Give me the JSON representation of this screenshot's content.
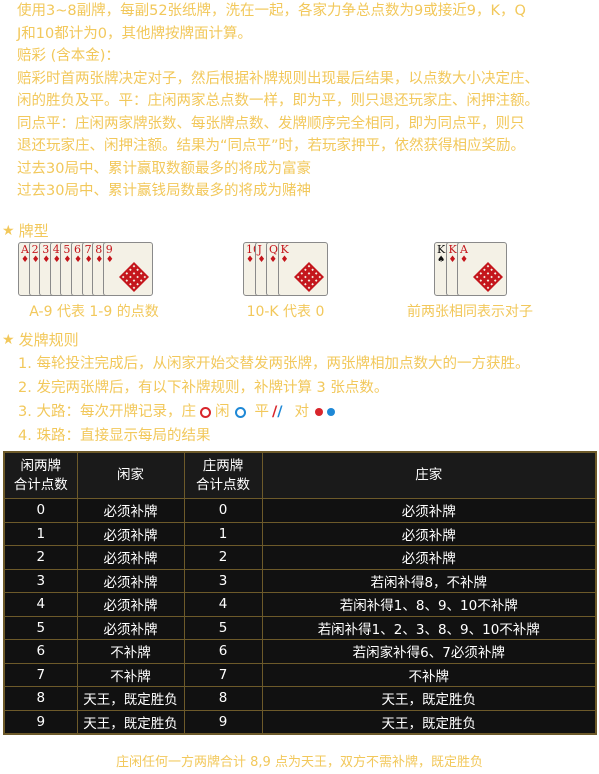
{
  "intro": [
    "使用3~8副牌，每副52张纸牌，洗在一起，各家力争总点数为9或接近9，K，Q",
    "J和10都计为0，其他牌按牌面计算。",
    "赔彩 (含本金)：",
    "赔彩时首两张牌决定对子，然后根据补牌规则出现最后结果，以点数大小决定庄、",
    "闲的胜负及平。平：庄闲两家总点数一样，即为平，则只退还玩家庄、闲押注额。",
    "同点平：庄闲两家牌张数、每张牌点数、发牌顺序完全相同，即为同点平，则只",
    "退还玩家庄、闲押注额。结果为“同点平”时，若玩家押平，依然获得相应奖励。",
    "过去30局中、累计赢取数额最多的将成为富豪",
    "过去30局中、累计赢钱局数最多的将成为赌神"
  ],
  "card_section": {
    "title": "牌型",
    "groups": [
      {
        "ranks": [
          "A",
          "2",
          "3",
          "4",
          "5",
          "6",
          "7",
          "8",
          "9"
        ],
        "caption": "A-9 代表 1-9 的点数"
      },
      {
        "ranks": [
          "10",
          "J",
          "Q",
          "K"
        ],
        "caption": "10-K 代表 0"
      },
      {
        "ranks": [
          "K",
          "K",
          "A"
        ],
        "caption": "前两张相同表示对子"
      }
    ]
  },
  "deal_section": {
    "title": "发牌规则",
    "rule1": "1. 每轮投注完成后，从闲家开始交替发两张牌，两张牌相加点数大的一方获胜。",
    "rule2": "2. 发完两张牌后，有以下补牌规则，补牌计算 3 张点数。",
    "rule3_prefix": "3. 大路：每次开牌记录，庄",
    "rule3_player": "闲",
    "rule3_tie": "平",
    "rule3_pair": "对",
    "rule4": "4. 珠路：直接显示每局的结果"
  },
  "table": {
    "headers": [
      "闲两牌\n合计点数",
      "闲家",
      "庄两牌\n合计点数",
      "庄家"
    ],
    "header_col1_line1": "闲两牌",
    "header_col1_line2": "合计点数",
    "header_col2": "闲家",
    "header_col3_line1": "庄两牌",
    "header_col3_line2": "合计点数",
    "header_col4": "庄家",
    "rows": [
      [
        "0",
        "必须补牌",
        "0",
        "必须补牌"
      ],
      [
        "1",
        "必须补牌",
        "1",
        "必须补牌"
      ],
      [
        "2",
        "必须补牌",
        "2",
        "必须补牌"
      ],
      [
        "3",
        "必须补牌",
        "3",
        "若闲补得8，不补牌"
      ],
      [
        "4",
        "必须补牌",
        "4",
        "若闲补得1、8、9、10不补牌"
      ],
      [
        "5",
        "必须补牌",
        "5",
        "若闲补得1、2、3、8、9、10不补牌"
      ],
      [
        "6",
        "不补牌",
        "6",
        "若闲家补得6、7必须补牌"
      ],
      [
        "7",
        "不补牌",
        "7",
        "不补牌"
      ],
      [
        "8",
        "天王，既定胜负",
        "8",
        "天王，既定胜负"
      ],
      [
        "9",
        "天王，既定胜负",
        "9",
        "天王，既定胜负"
      ]
    ]
  },
  "footer": "庄闲任何一方两牌合计 8,9 点为天王，双方不需补牌，既定胜负",
  "colors": {
    "gold_text": "#f2c85b",
    "table_bg": "#111111",
    "table_border": "#6d5a2a",
    "red": "#c4161c",
    "blue": "#1e88d6"
  }
}
